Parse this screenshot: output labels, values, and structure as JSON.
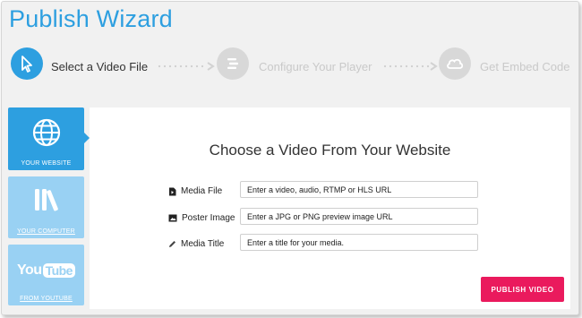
{
  "app": {
    "title": "Publish Wizard"
  },
  "steps": [
    {
      "label": "Select a Video File",
      "icon": "cursor-icon",
      "state": "active"
    },
    {
      "label": "Configure Your Player",
      "icon": "menu-lines-icon",
      "state": "inactive"
    },
    {
      "label": "Get Embed Code",
      "icon": "cloud-icon",
      "state": "inactive"
    }
  ],
  "sources": [
    {
      "label": "YOUR WEBSITE",
      "icon": "globe-icon",
      "selected": true
    },
    {
      "label": "YOUR COMPUTER",
      "icon": "library-icon",
      "selected": false
    },
    {
      "label": "FROM YOUTUBE",
      "icon": "youtube-icon",
      "logo_text": "YouTube",
      "selected": false
    }
  ],
  "form": {
    "heading": "Choose a Video From Your Website",
    "fields": [
      {
        "label": "Media File",
        "icon": "file-icon",
        "placeholder": "Enter a video, audio, RTMP or HLS URL",
        "value": ""
      },
      {
        "label": "Poster Image",
        "icon": "image-icon",
        "placeholder": "Enter a JPG or PNG preview image URL",
        "value": ""
      },
      {
        "label": "Media Title",
        "icon": "pencil-icon",
        "placeholder": "Enter a title for your media.",
        "value": ""
      }
    ],
    "submit_label": "PUBLISH VIDEO"
  },
  "colors": {
    "accent": "#2d9fe0",
    "accent_light": "#99d1f3",
    "button": "#ea1a5d",
    "inactive_step": "#c9c9c9"
  }
}
